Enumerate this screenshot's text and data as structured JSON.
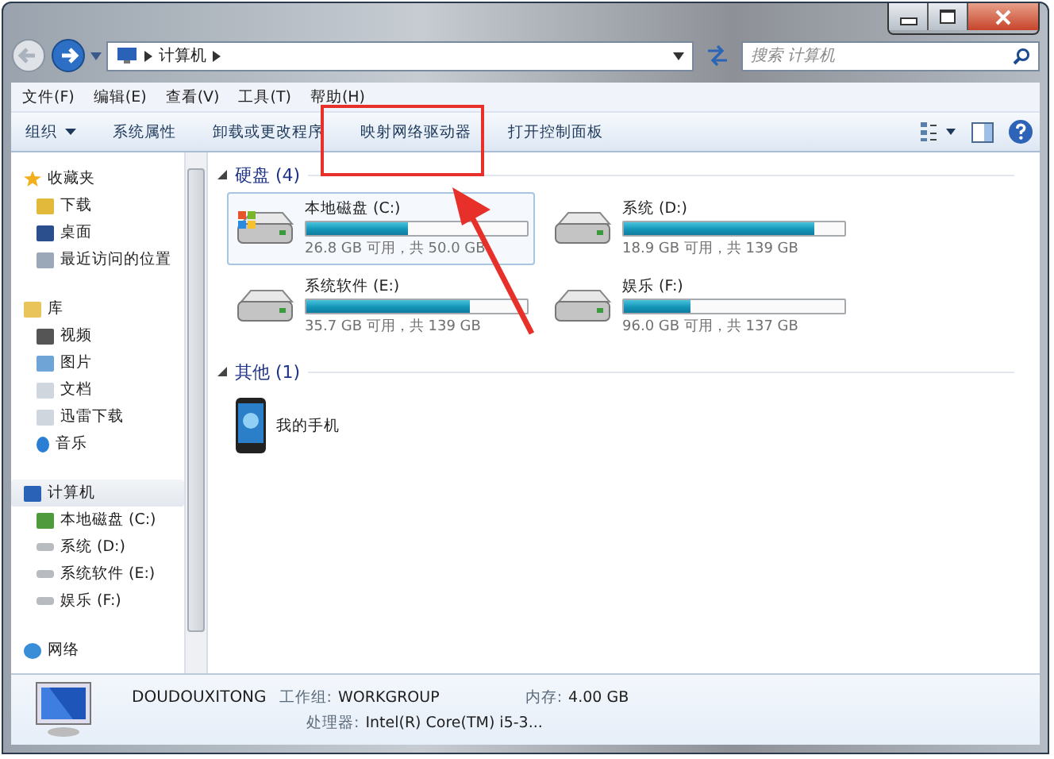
{
  "address": {
    "path": [
      "计算机"
    ]
  },
  "search": {
    "placeholder": "搜索 计算机"
  },
  "menu": [
    "文件(F)",
    "编辑(E)",
    "查看(V)",
    "工具(T)",
    "帮助(H)"
  ],
  "toolbar": [
    {
      "label": "组织",
      "dropdown": true
    },
    {
      "label": "系统属性",
      "dropdown": false
    },
    {
      "label": "卸载或更改程序",
      "dropdown": false
    },
    {
      "label": "映射网络驱动器",
      "dropdown": false
    },
    {
      "label": "打开控制面板",
      "dropdown": false
    }
  ],
  "sidebar": [
    {
      "label": "收藏夹",
      "kind": "star",
      "selected": false,
      "children": [
        {
          "label": "下载",
          "kind": "download"
        },
        {
          "label": "桌面",
          "kind": "desktop"
        },
        {
          "label": "最近访问的位置",
          "kind": "recent"
        }
      ]
    },
    {
      "label": "库",
      "kind": "library",
      "selected": false,
      "children": [
        {
          "label": "视频",
          "kind": "video"
        },
        {
          "label": "图片",
          "kind": "picture"
        },
        {
          "label": "文档",
          "kind": "document"
        },
        {
          "label": "迅雷下载",
          "kind": "document"
        },
        {
          "label": "音乐",
          "kind": "music"
        }
      ]
    },
    {
      "label": "计算机",
      "kind": "computer",
      "selected": true,
      "children": [
        {
          "label": "本地磁盘 (C:)",
          "kind": "sysdrive"
        },
        {
          "label": "系统 (D:)",
          "kind": "drive"
        },
        {
          "label": "系统软件 (E:)",
          "kind": "drive"
        },
        {
          "label": "娱乐 (F:)",
          "kind": "drive"
        }
      ]
    },
    {
      "label": "网络",
      "kind": "network",
      "selected": false
    }
  ],
  "groups": [
    {
      "title": "硬盘 (4)",
      "items": [
        {
          "name": "本地磁盘 (C:)",
          "kind": "sysdrive",
          "level": 0.46,
          "space": "26.8 GB 可用，共 50.0 GB",
          "selected": true
        },
        {
          "name": "系统 (D:)",
          "kind": "drive",
          "level": 0.86,
          "space": "18.9 GB 可用，共 139 GB",
          "selected": false
        },
        {
          "name": "系统软件 (E:)",
          "kind": "drive",
          "level": 0.74,
          "space": "35.7 GB 可用，共 139 GB",
          "selected": false
        },
        {
          "name": "娱乐 (F:)",
          "kind": "drive",
          "level": 0.3,
          "space": "96.0 GB 可用，共 137 GB",
          "selected": false
        }
      ]
    },
    {
      "title": "其他 (1)",
      "items": [
        {
          "name": "我的手机",
          "kind": "phone",
          "selected": false
        }
      ]
    }
  ],
  "details": {
    "computer_name": "DOUDOUXITONG",
    "rows": [
      {
        "label": "工作组:",
        "value": "WORKGROUP"
      },
      {
        "label": "内存:",
        "value": "4.00 GB"
      },
      {
        "label": "处理器:",
        "value": "Intel(R) Core(TM) i5-3..."
      }
    ]
  }
}
